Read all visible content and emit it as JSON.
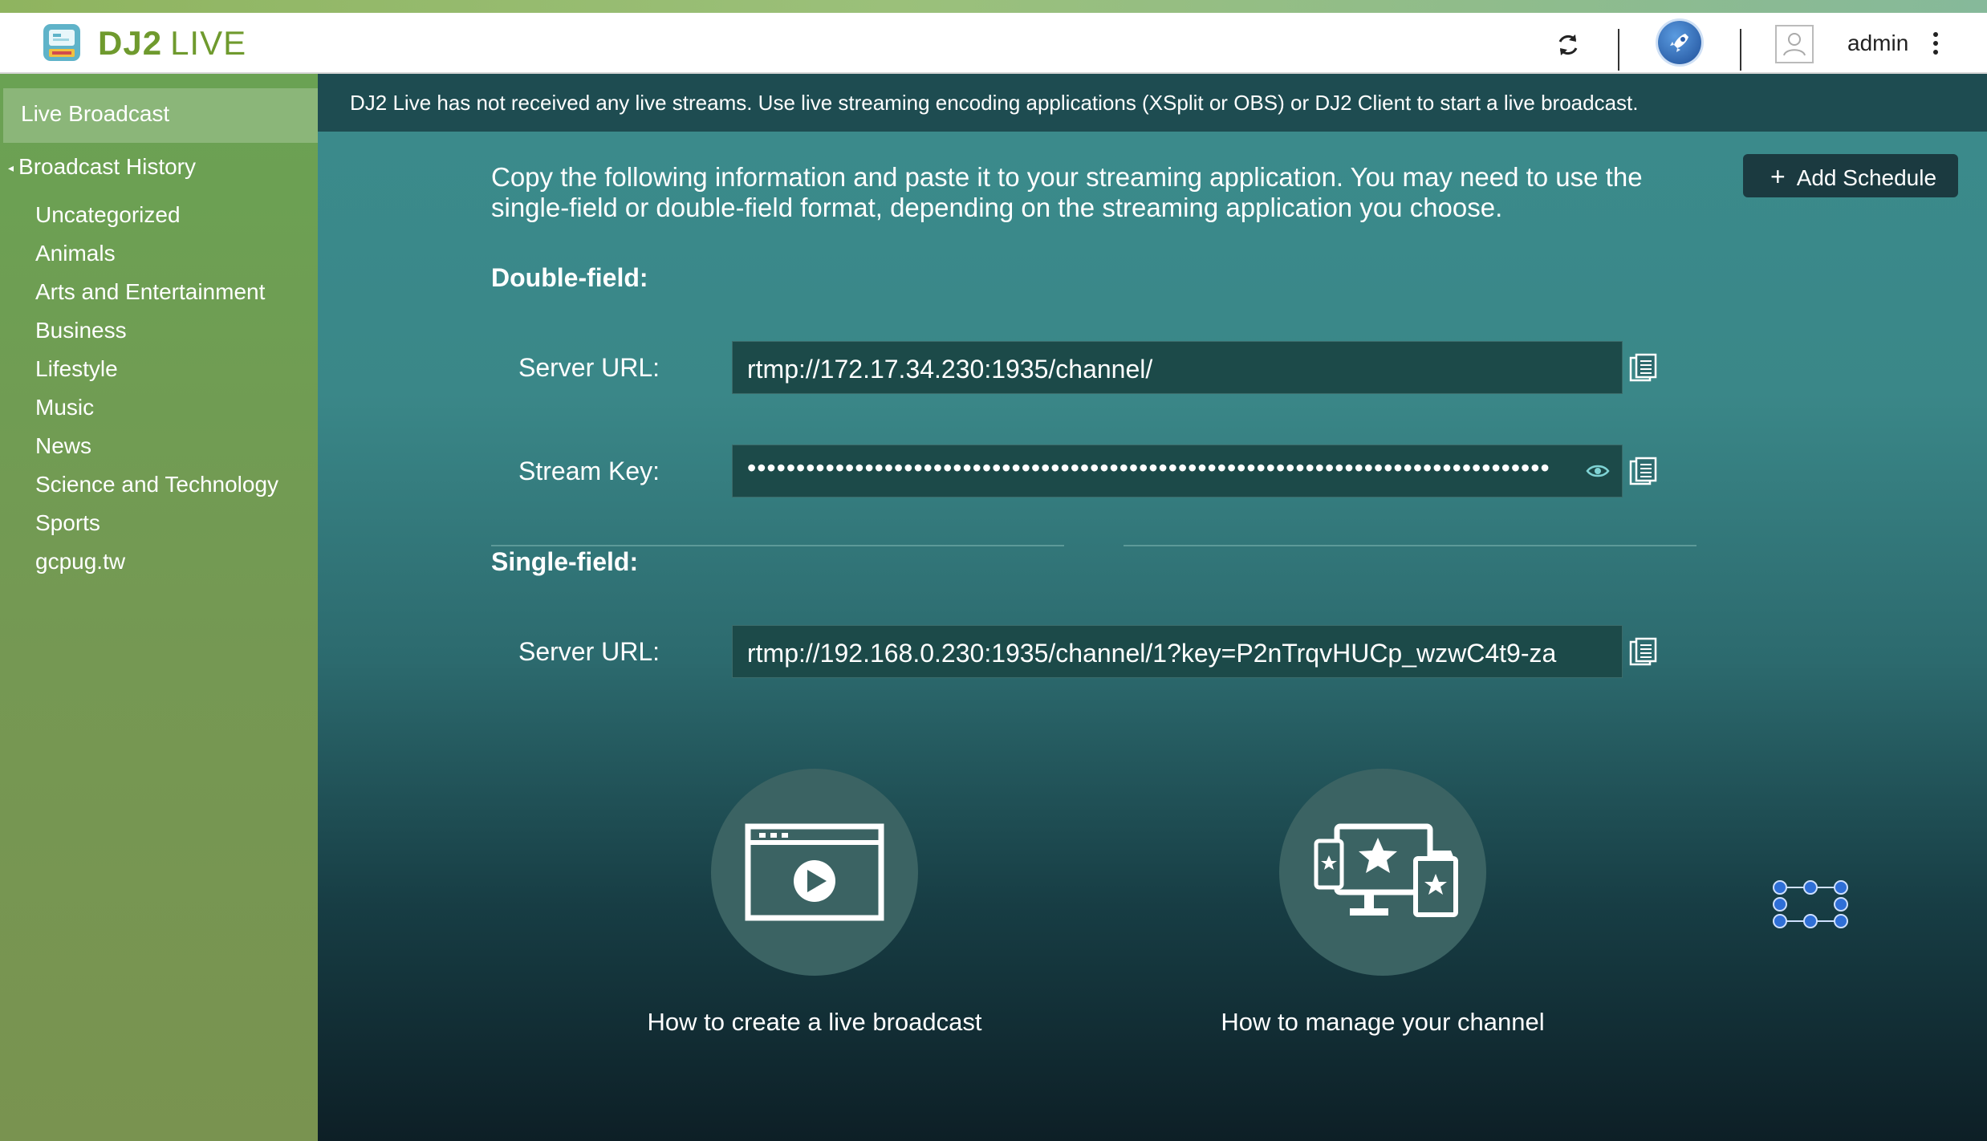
{
  "app": {
    "brand_bold": "DJ2",
    "brand_light": "LIVE",
    "logo_icon": "dj2-live-logo-icon",
    "accent_color": "#6f9a2e"
  },
  "header": {
    "refresh_icon": "refresh-icon",
    "rocket_icon": "rocket-icon",
    "avatar_icon": "user-avatar-icon",
    "username": "admin",
    "menu_icon": "more-vertical-icon"
  },
  "sidebar": {
    "live_broadcast": "Live Broadcast",
    "history_label": "Broadcast History",
    "history_items": [
      "Uncategorized",
      "Animals",
      "Arts and Entertainment",
      "Business",
      "Lifestyle",
      "Music",
      "News",
      "Science and Technology",
      "Sports",
      "gcpug.tw"
    ]
  },
  "main": {
    "banner": "DJ2 Live has not received any live streams. Use live streaming encoding applications (XSplit or OBS) or DJ2 Client to start a live broadcast.",
    "intro": "Copy the following information and paste it to your streaming application. You may need to use the single-field or double-field format, depending on the streaming application you choose.",
    "add_schedule": "Add Schedule",
    "add_schedule_symbol": "+",
    "double_field": {
      "title": "Double-field:",
      "server_label": "Server URL:",
      "server_value": "rtmp://172.17.34.230:1935/channel/",
      "key_label": "Stream Key:",
      "key_value": "••••••••••••••••••••••••••••••••••••••••••••••••••••••••••••••••••••••••••••••••••"
    },
    "single_field": {
      "title": "Single-field:",
      "server_label": "Server URL:",
      "server_value": "rtmp://192.168.0.230:1935/channel/1?key=P2nTrqvHUCp_wzwC4t9-za"
    },
    "help": [
      {
        "label": "How to create a live broadcast",
        "icon": "video-player-icon"
      },
      {
        "label": "How to manage your channel",
        "icon": "channel-devices-icon"
      }
    ],
    "floating_icon": "network-nodes-icon"
  }
}
